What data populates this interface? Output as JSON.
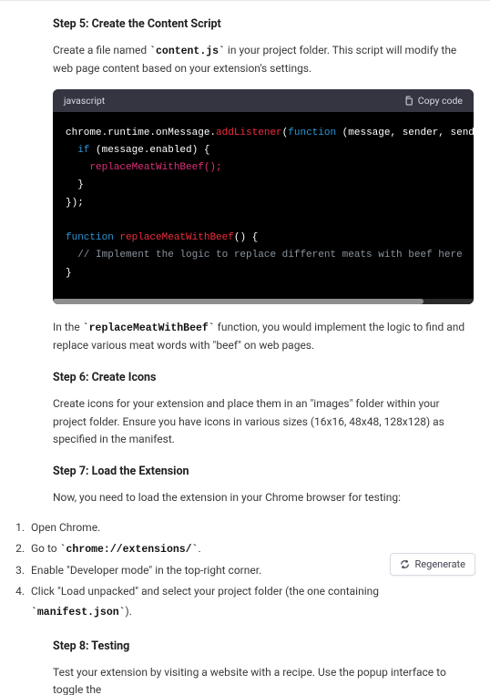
{
  "step5": {
    "heading": "Step 5: Create the Content Script",
    "intro_before": "Create a file named ",
    "intro_code": "`content.js`",
    "intro_after": " in your project folder. This script will modify the web page content based on your extension's settings.",
    "after_before": "In the ",
    "after_code": "`replaceMeatWithBeef`",
    "after_after": " function, you would implement the logic to find and replace various meat words with \"beef\" on web pages."
  },
  "code": {
    "lang": "javascript",
    "copy_label": "Copy code",
    "tokens": {
      "l1a": "chrome.runtime.onMessage.",
      "l1b": "addListener",
      "l1c": "(",
      "l1d": "function",
      "l1e": " (message, sender, sendResponse) {",
      "l2a": "if",
      "l2b": " (message.enabled) {",
      "l3": "replaceMeatWithBeef();",
      "l4": "}",
      "l5": "});",
      "l7a": "function",
      "l7b": " ",
      "l7c": "replaceMeatWithBeef",
      "l7d": "() {",
      "l8": "// Implement the logic to replace different meats with beef here",
      "l9": "}"
    }
  },
  "step6": {
    "heading": "Step 6: Create Icons",
    "body": "Create icons for your extension and place them in an \"images\" folder within your project folder. Ensure you have icons in various sizes (16x16, 48x48, 128x128) as specified in the manifest."
  },
  "step7": {
    "heading": "Step 7: Load the Extension",
    "intro": "Now, you need to load the extension in your Chrome browser for testing:",
    "items": {
      "i1": "Open Chrome.",
      "i2_before": "Go to ",
      "i2_code": "`chrome://extensions/`",
      "i2_after": ".",
      "i3": "Enable \"Developer mode\" in the top-right corner.",
      "i4_before": "Click \"Load unpacked\" and select your project folder (the one containing ",
      "i4_code": "`manifest.json`",
      "i4_after": ")."
    }
  },
  "step8": {
    "heading": "Step 8: Testing",
    "body": "Test your extension by visiting a website with a recipe. Use the popup interface to toggle the"
  },
  "regenerate": "Regenerate"
}
